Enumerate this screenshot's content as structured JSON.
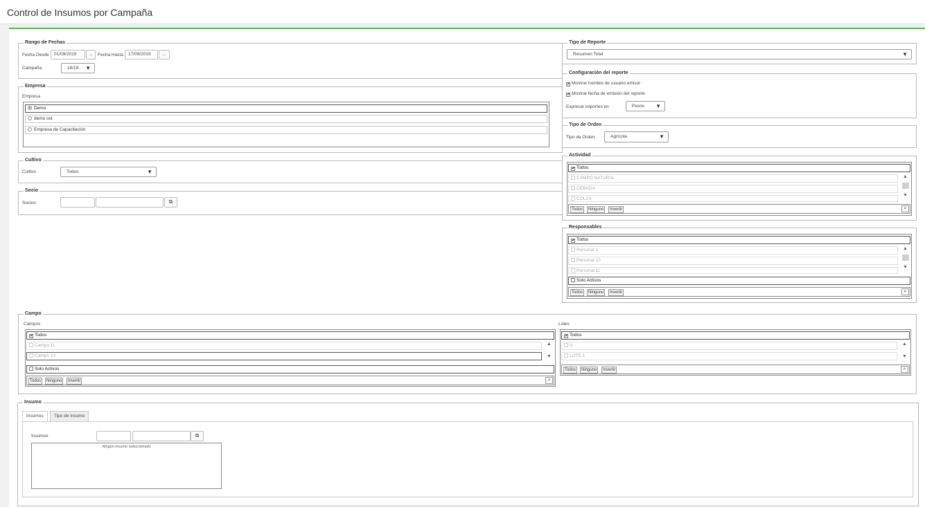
{
  "page": {
    "title": "Control de Insumos por Campaña"
  },
  "rango_fechas": {
    "legend": "Rango de Fechas",
    "fecha_desde_label": "Fecha Desde",
    "fecha_desde_value": "01/09/2019",
    "fecha_hasta_label": "Fecha Hasta",
    "fecha_hasta_value": "17/09/2019",
    "picker_label": "...",
    "campana_label": "Campaña",
    "campana_value": "18/19"
  },
  "empresa": {
    "legend": "Empresa",
    "label": "Empresa",
    "options": [
      {
        "label": "Demo",
        "selected": true
      },
      {
        "label": "demo ost",
        "selected": false
      },
      {
        "label": "Empresa de Capacitación",
        "selected": false
      }
    ]
  },
  "cultivo": {
    "legend": "Cultivo",
    "label": "Cultivo",
    "value": "Todos"
  },
  "socio": {
    "legend": "Socio",
    "label": "Socios:",
    "code_value": "",
    "name_value": ""
  },
  "tipo_reporte": {
    "legend": "Tipo de Reporte",
    "value": "Resumen Total"
  },
  "config": {
    "legend": "Configuración del reporte",
    "mostrar_usuario": "Mostrar nombre de usuario emisor",
    "mostrar_fecha": "Mostrar fecha de emisión del reporte",
    "expresar_label": "Expresar importes en",
    "expresar_value": "Pesos"
  },
  "tipo_orden": {
    "legend": "Tipo de Orden",
    "label": "Tipo de Orden",
    "value": "Agrícola"
  },
  "actividad": {
    "legend": "Actividad",
    "todos": "Todos",
    "items": [
      "CAMPO NATURAL",
      "CEBADA",
      "COLZA"
    ]
  },
  "responsables": {
    "legend": "Responsables",
    "todos": "Todos",
    "items": [
      "Personal 1",
      "Personal 10",
      "Personal 11"
    ],
    "solo_activos": "Solo Activos"
  },
  "campo": {
    "legend": "Campo",
    "campos_label": "Campos",
    "campos_todos": "Todos",
    "campos_items": [
      "Campo 11",
      "Campo 13"
    ],
    "solo_activos": "Solo Activos",
    "lotes_label": "Lotes",
    "lotes_todos": "Todos",
    "lotes_items": [
      "l1",
      "LOTE 1"
    ]
  },
  "list_buttons": {
    "todos": "Todos",
    "ninguno": "Ninguno",
    "invertir": "Invertir"
  },
  "insumo": {
    "legend": "Insumo",
    "tabs": [
      "Insumos",
      "Tipo de insumo"
    ],
    "label": "Insumos",
    "empty_text": "Ningún insumo seleccionado"
  },
  "icons": {
    "dropdown": "caret-down-icon",
    "external": "external-link-icon",
    "search": "search-icon",
    "scroll_up": "arrow-up-icon",
    "scroll_down": "arrow-down-icon"
  },
  "colors": {
    "accent": "#3cc43c",
    "border": "#b8b8b8"
  }
}
